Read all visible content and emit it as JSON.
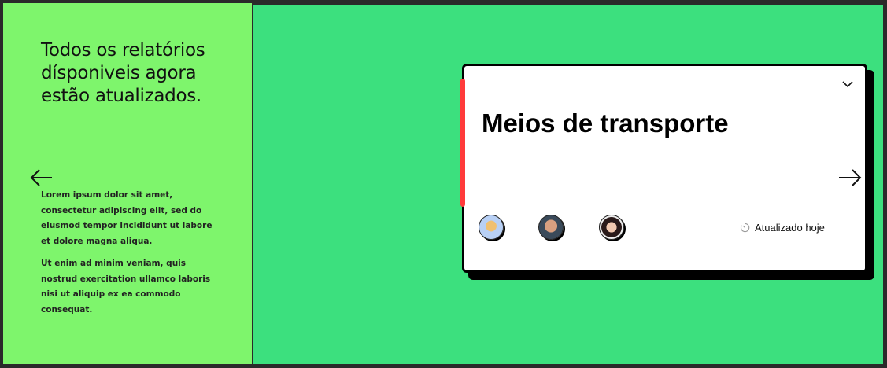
{
  "colors": {
    "left_panel": "#7ef56c",
    "right_panel": "#3ce07e",
    "accent_bar": "#ff3b3b"
  },
  "sidebar": {
    "heading": "Todos os relatórios dísponiveis agora estão atualizados.",
    "back_icon": "arrow-left-icon",
    "paragraphs": [
      "Lorem ipsum dolor sit amet, consectetur adipiscing elit, sed do eiusmod tempor incididunt ut labore et dolore magna aliqua.",
      "Ut enim ad minim veniam, quis nostrud exercitation ullamco laboris nisi ut aliquip ex ea commodo consequat."
    ]
  },
  "card": {
    "title": "Meios de transporte",
    "expand_icon": "chevron-down-icon",
    "next_icon": "arrow-right-icon",
    "avatars": [
      "avatar-1",
      "avatar-2",
      "avatar-3"
    ],
    "status_icon": "timer-icon",
    "status": "Atualizado hoje"
  }
}
